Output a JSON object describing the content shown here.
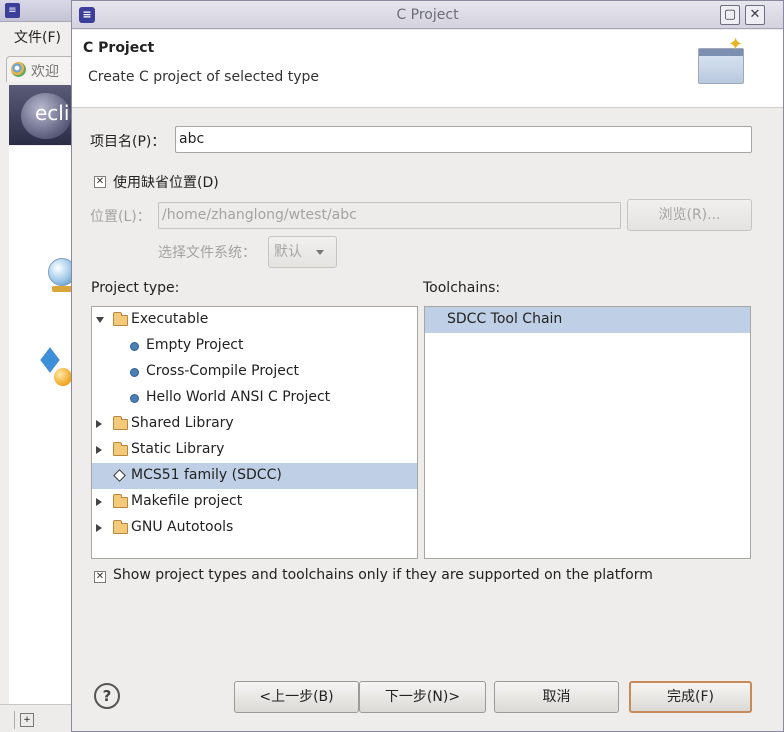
{
  "background": {
    "menu_file": "文件(F)",
    "tab_welcome": "欢迎",
    "tab_close": "×",
    "banner_text": "ecli"
  },
  "dialog": {
    "title": "C Project",
    "header": {
      "title": "C Project",
      "description": "Create C project of selected type"
    },
    "project_name": {
      "label": "项目名(P)：",
      "value": "abc"
    },
    "use_default_location": {
      "label": "使用缺省位置(D)",
      "checked": true
    },
    "location": {
      "label": "位置(L)：",
      "value": "/home/zhanglong/wtest/abc",
      "browse_label": "浏览(R)..."
    },
    "filesystem": {
      "label": "选择文件系统：",
      "selected": "默认"
    },
    "project_type": {
      "label": "Project type:",
      "items": [
        {
          "label": "Executable",
          "kind": "folder",
          "expander": "open",
          "level": 0,
          "selected": false
        },
        {
          "label": "Empty Project",
          "kind": "item",
          "expander": "none",
          "level": 1,
          "selected": false
        },
        {
          "label": "Cross-Compile Project",
          "kind": "item",
          "expander": "none",
          "level": 1,
          "selected": false
        },
        {
          "label": "Hello World ANSI C Project",
          "kind": "item",
          "expander": "none",
          "level": 1,
          "selected": false
        },
        {
          "label": "Shared Library",
          "kind": "folder",
          "expander": "closed",
          "level": 0,
          "selected": false
        },
        {
          "label": "Static Library",
          "kind": "folder",
          "expander": "closed",
          "level": 0,
          "selected": false
        },
        {
          "label": "MCS51 family (SDCC)",
          "kind": "diamond",
          "expander": "none",
          "level": 0,
          "selected": true
        },
        {
          "label": "Makefile project",
          "kind": "folder",
          "expander": "closed",
          "level": 0,
          "selected": false
        },
        {
          "label": "GNU Autotools",
          "kind": "folder",
          "expander": "closed",
          "level": 0,
          "selected": false
        }
      ]
    },
    "toolchains": {
      "label": "Toolchains:",
      "items": [
        {
          "label": "SDCC Tool Chain",
          "selected": true
        }
      ]
    },
    "show_supported": {
      "label": "Show project types and toolchains only if they are supported on the platform",
      "checked": true
    },
    "buttons": {
      "help": "?",
      "back": "<上一步(B)",
      "next": "下一步(N)>",
      "cancel": "取消",
      "finish": "完成(F)"
    },
    "colors": {
      "selection": "#bfd0e6",
      "default_button_border": "#c98a5a"
    }
  }
}
